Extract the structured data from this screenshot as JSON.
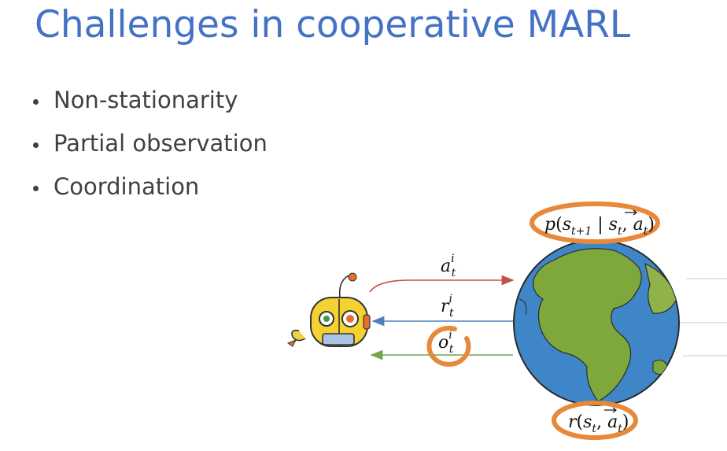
{
  "title": "Challenges in cooperative MARL",
  "bullets": [
    "Non-stationarity",
    "Partial observation",
    "Coordination"
  ],
  "diagram": {
    "action_label": "a",
    "reward_label": "r",
    "obs_label": "o",
    "agent_index": "i",
    "time_index": "t",
    "transition": {
      "p": "p",
      "s": "s",
      "next_sub": "t+1",
      "a": "a",
      "t": "t"
    },
    "reward_fn": {
      "r": "r",
      "s": "s",
      "a": "a",
      "t": "t"
    },
    "colors": {
      "title": "#4472c4",
      "circle": "#e8883a",
      "action_arrow": "#c0504d",
      "reward_arrow": "#4f81bd",
      "obs_arrow": "#77a050"
    },
    "icons": [
      "robot-agent-icon",
      "earth-globe-icon"
    ]
  }
}
